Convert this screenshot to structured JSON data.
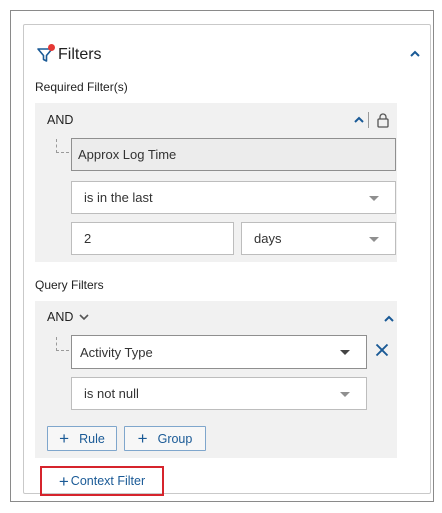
{
  "header": {
    "title": "Filters"
  },
  "required": {
    "section_label": "Required Filter(s)",
    "operator": "AND",
    "field": "Approx Log Time",
    "condition": "is in the last",
    "value": "2",
    "unit": "days"
  },
  "query": {
    "section_label": "Query Filters",
    "operator": "AND",
    "field": "Activity Type",
    "condition": "is not null",
    "buttons": {
      "rule": "Rule",
      "group": "Group"
    },
    "context_filter": "Context Filter"
  },
  "colors": {
    "accent": "#1a5a96",
    "highlight": "#d6242c",
    "badge": "#e53935"
  },
  "icons": [
    "filter-icon",
    "chevron-up-icon",
    "chevron-down-icon",
    "lock-icon",
    "close-icon",
    "plus-icon"
  ]
}
